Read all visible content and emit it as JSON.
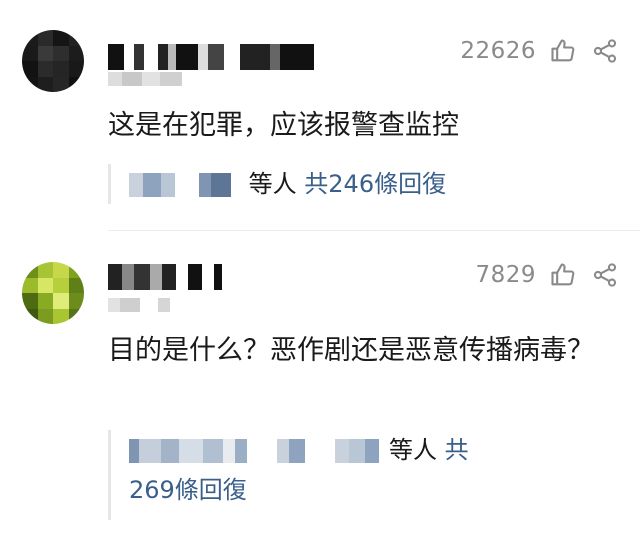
{
  "comments": [
    {
      "likes": "22626",
      "text": "这是在犯罪，应该报警查监控",
      "reply_suffix": "等人",
      "reply_link": "共246條回復",
      "colors": {
        "link": "#3a5f8a",
        "meta": "#8a8a8a"
      },
      "icons": [
        "thumbs-up-icon",
        "share-icon"
      ]
    },
    {
      "likes": "7829",
      "text": "目的是什么？恶作剧还是恶意传播病毒？",
      "reply_suffix": "等人",
      "reply_link_prefix": "共",
      "reply_link": "269條回復",
      "colors": {
        "link": "#3a5f8a",
        "meta": "#8a8a8a"
      },
      "icons": [
        "thumbs-up-icon",
        "share-icon"
      ]
    }
  ]
}
